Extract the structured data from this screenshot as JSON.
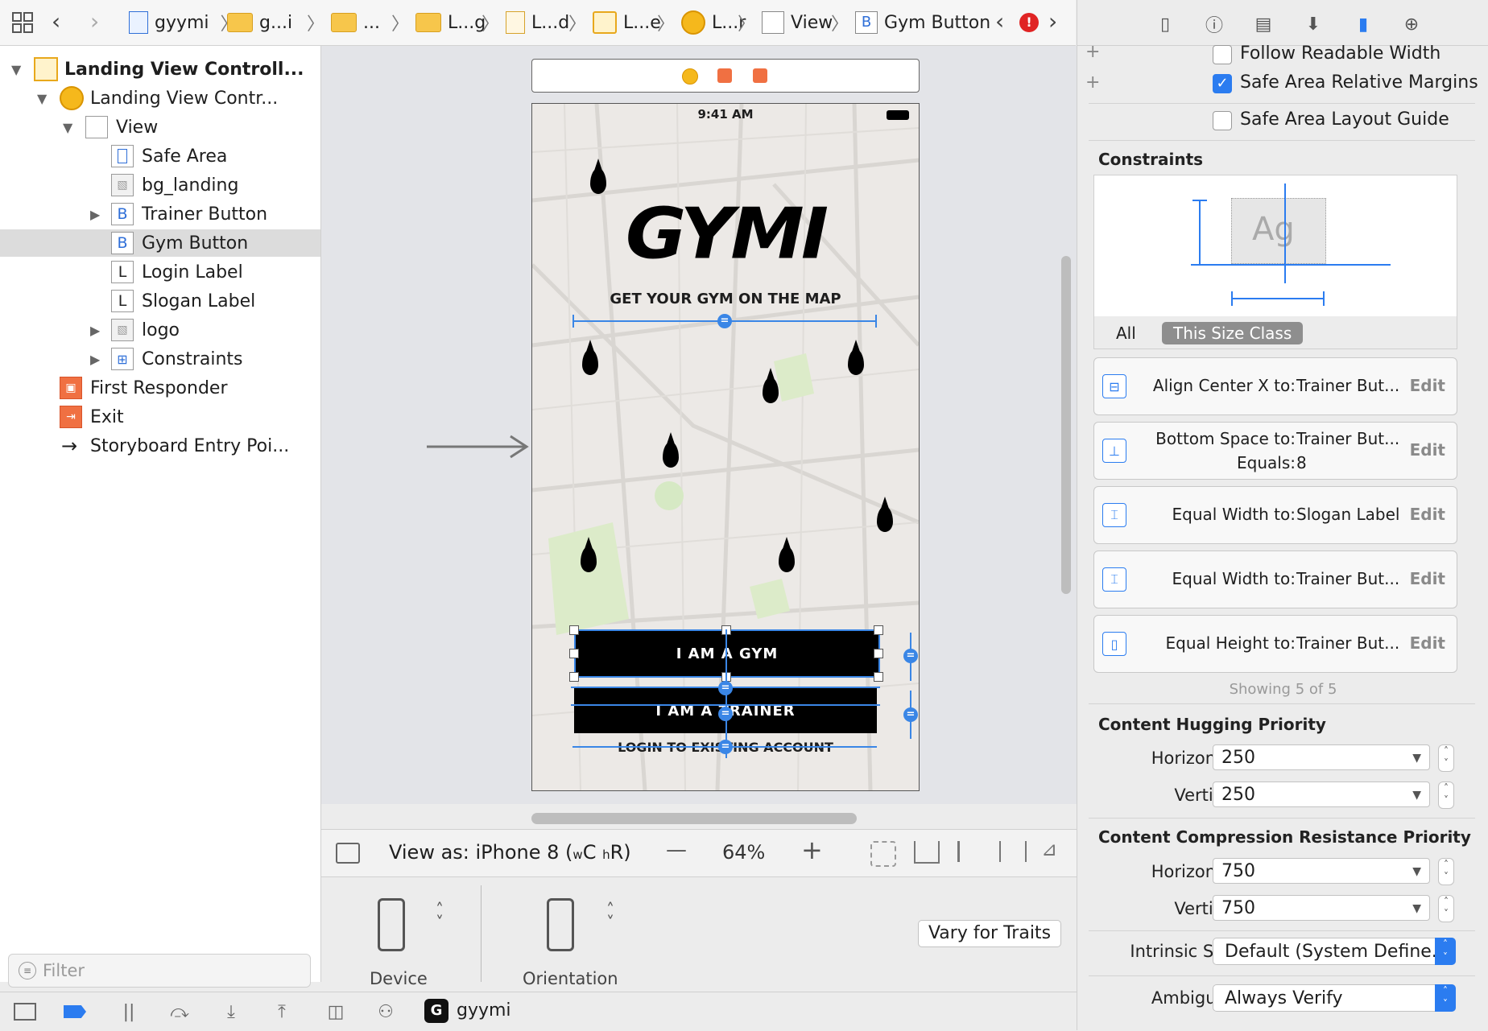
{
  "jumpbar": {
    "crumbs": [
      "gyymi",
      "g...i",
      "...",
      "L...g",
      "L...d",
      "L...e",
      "L...r",
      "View",
      "Gym Button"
    ],
    "error_icon": "error-badge-icon"
  },
  "navigator": {
    "items": [
      {
        "label": "Landing View Controll...",
        "icon": "scene-icon"
      },
      {
        "label": "Landing View Contr...",
        "icon": "view-controller-icon"
      },
      {
        "label": "View",
        "icon": "view-icon"
      },
      {
        "label": "Safe Area",
        "icon": "safe-area-icon"
      },
      {
        "label": "bg_landing",
        "icon": "image-view-icon"
      },
      {
        "label": "Trainer Button",
        "icon": "button-icon",
        "badge": "B"
      },
      {
        "label": "Gym Button",
        "icon": "button-icon",
        "badge": "B"
      },
      {
        "label": "Login Label",
        "icon": "label-icon",
        "badge": "L"
      },
      {
        "label": "Slogan Label",
        "icon": "label-icon",
        "badge": "L"
      },
      {
        "label": "logo",
        "icon": "image-view-icon"
      },
      {
        "label": "Constraints",
        "icon": "constraints-icon"
      },
      {
        "label": "First Responder",
        "icon": "first-responder-icon"
      },
      {
        "label": "Exit",
        "icon": "exit-icon"
      },
      {
        "label": "Storyboard Entry Poi...",
        "icon": "arrow-right-icon"
      }
    ],
    "filter_placeholder": "Filter"
  },
  "canvas": {
    "status_time": "9:41 AM",
    "logo_text": "GYMI",
    "slogan": "GET YOUR GYM ON THE MAP",
    "gym_button": "I AM A GYM",
    "trainer_button": "I AM A TRAINER",
    "login_label": "LOGIN TO EXISTING ACCOUNT"
  },
  "editor": {
    "view_as": "View as: iPhone 8 (",
    "size_w": "w",
    "size_c": "C",
    "size_h": "h",
    "size_r": "R)",
    "zoom": "64%",
    "minus": "—",
    "plus": "+",
    "device_label": "Device",
    "orientation_label": "Orientation",
    "vary_button": "Vary for Traits"
  },
  "inspector": {
    "follow_readable": "Follow Readable Width",
    "safe_area_margins": "Safe Area Relative Margins",
    "safe_area_guide": "Safe Area Layout Guide",
    "constraints_title": "Constraints",
    "preview_text": "Ag",
    "tab_all": "All",
    "tab_size_class": "This Size Class",
    "constraints": [
      {
        "label": "Align Center X to:",
        "value": "Trainer But...",
        "extra_label": "",
        "extra_value": ""
      },
      {
        "label": "Bottom Space to:",
        "value": "Trainer But...",
        "extra_label": "Equals:",
        "extra_value": "8"
      },
      {
        "label": "Equal Width to:",
        "value": "Slogan Label",
        "extra_label": "",
        "extra_value": ""
      },
      {
        "label": "Equal Width to:",
        "value": "Trainer But...",
        "extra_label": "",
        "extra_value": ""
      },
      {
        "label": "Equal Height to:",
        "value": "Trainer But...",
        "extra_label": "",
        "extra_value": ""
      }
    ],
    "edit_label": "Edit",
    "showing": "Showing 5 of 5",
    "hugging_title": "Content Hugging Priority",
    "hugging_h_label": "Horizontal",
    "hugging_h": "250",
    "hugging_v_label": "Vertical",
    "hugging_v": "250",
    "compression_title": "Content Compression Resistance Priority",
    "compression_h_label": "Horizontal",
    "compression_h": "750",
    "compression_v_label": "Vertical",
    "compression_v": "750",
    "intrinsic_label": "Intrinsic Size",
    "intrinsic_value": "Default (System Define...",
    "ambiguity_label": "Ambiguity",
    "ambiguity_value": "Always Verify"
  },
  "bottombar": {
    "project": "gyymi"
  },
  "colors": {
    "accent": "#2b7cf0",
    "constraint_blue": "#3a86e6",
    "error": "#e02424",
    "folder": "#f7c64b"
  }
}
